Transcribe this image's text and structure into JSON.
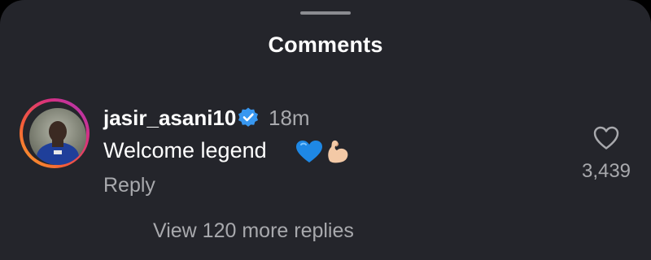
{
  "sheet": {
    "title": "Comments"
  },
  "comment": {
    "username": "jasir_asani10",
    "verified_icon": "verified-badge-icon",
    "timestamp": "18m",
    "text": "Welcome legend",
    "emojis": [
      "blue-heart-emoji",
      "flexed-biceps-emoji"
    ],
    "reply_label": "Reply",
    "like_icon": "heart-outline-icon",
    "like_count": "3,439",
    "view_replies_label": "View 120 more replies"
  },
  "colors": {
    "sheet_background": "#24252b",
    "primary_text": "#ffffff",
    "secondary_text": "#a8a9ad",
    "verified_blue": "#3897f0"
  }
}
